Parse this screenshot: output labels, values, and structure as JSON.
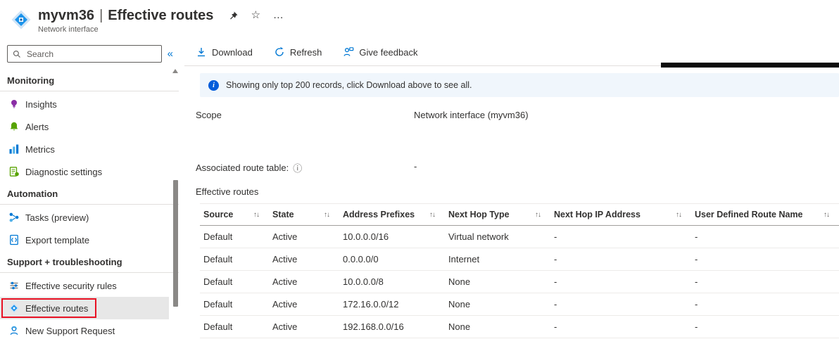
{
  "header": {
    "title": "myvm36",
    "title_separator": "|",
    "title_page": "Effective routes",
    "subtitle": "Network interface",
    "pin_glyph": "",
    "star_glyph": "☆",
    "ellipsis_glyph": "…"
  },
  "sidebar": {
    "search_placeholder": "Search",
    "collapse_glyph": "«",
    "sections": [
      {
        "label": "Monitoring",
        "items": [
          {
            "label": "Insights",
            "icon": "insights-icon"
          },
          {
            "label": "Alerts",
            "icon": "alerts-icon"
          },
          {
            "label": "Metrics",
            "icon": "metrics-icon"
          },
          {
            "label": "Diagnostic settings",
            "icon": "diagnostic-settings-icon"
          }
        ]
      },
      {
        "label": "Automation",
        "items": [
          {
            "label": "Tasks (preview)",
            "icon": "tasks-icon"
          },
          {
            "label": "Export template",
            "icon": "export-template-icon"
          }
        ]
      },
      {
        "label": "Support + troubleshooting",
        "items": [
          {
            "label": "Effective security rules",
            "icon": "effective-security-rules-icon"
          },
          {
            "label": "Effective routes",
            "icon": "effective-routes-icon",
            "active": true
          },
          {
            "label": "New Support Request",
            "icon": "support-request-icon"
          }
        ]
      }
    ]
  },
  "toolbar": {
    "download_label": "Download",
    "refresh_label": "Refresh",
    "feedback_label": "Give feedback"
  },
  "banner": {
    "text": "Showing only top 200 records, click Download above to see all."
  },
  "scope": {
    "label": "Scope",
    "value": "Network interface (myvm36)"
  },
  "associated": {
    "label": "Associated route table:",
    "info_glyph": "ⓘ",
    "value": "-"
  },
  "section_title": "Effective routes",
  "table": {
    "sort_glyph": "↑↓",
    "columns": [
      "Source",
      "State",
      "Address Prefixes",
      "Next Hop Type",
      "Next Hop IP Address",
      "User Defined Route Name"
    ],
    "rows": [
      [
        "Default",
        "Active",
        "10.0.0.0/16",
        "Virtual network",
        "-",
        "-"
      ],
      [
        "Default",
        "Active",
        "0.0.0.0/0",
        "Internet",
        "-",
        "-"
      ],
      [
        "Default",
        "Active",
        "10.0.0.0/8",
        "None",
        "-",
        "-"
      ],
      [
        "Default",
        "Active",
        "172.16.0.0/12",
        "None",
        "-",
        "-"
      ],
      [
        "Default",
        "Active",
        "192.168.0.0/16",
        "None",
        "-",
        "-"
      ]
    ]
  },
  "colors": {
    "accent": "#0078d4",
    "banner_bg": "#f0f6fc",
    "highlight_red": "#e81123",
    "active_item_bg": "#e7e7e7",
    "text": "#323130",
    "muted_text": "#605e5c"
  }
}
